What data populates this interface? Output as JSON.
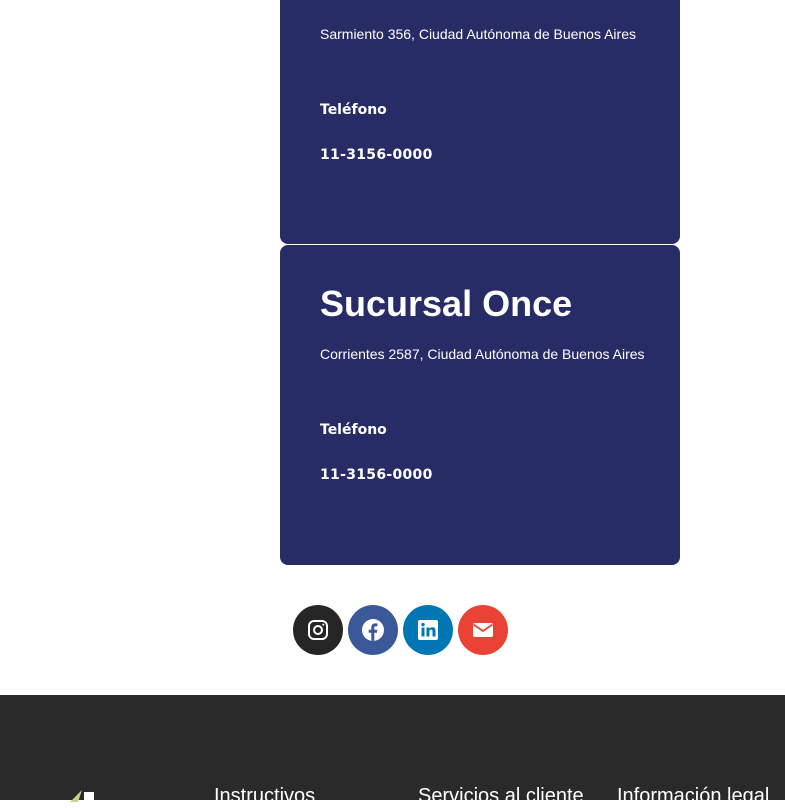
{
  "branches": [
    {
      "address": "Sarmiento 356, Ciudad Autónoma de Buenos Aires",
      "phone_label": "Teléfono",
      "phone": "11-3156-0000"
    },
    {
      "title": "Sucursal Once",
      "address": "Corrientes 2587, Ciudad Autónoma de Buenos Aires",
      "phone_label": "Teléfono",
      "phone": "11-3156-0000"
    }
  ],
  "social": {
    "icons": [
      "instagram-icon",
      "facebook-icon",
      "linkedin-icon",
      "envelope-icon"
    ],
    "colors": {
      "instagram": "#262626",
      "facebook": "#3b5998",
      "linkedin": "#0077b5",
      "email": "#ea4335"
    }
  },
  "footer": {
    "columns": [
      "Instructivos",
      "Servicios al cliente",
      "Información legal"
    ]
  },
  "colors": {
    "card_bg": "#282c66",
    "footer_bg": "#2a2a2a"
  }
}
